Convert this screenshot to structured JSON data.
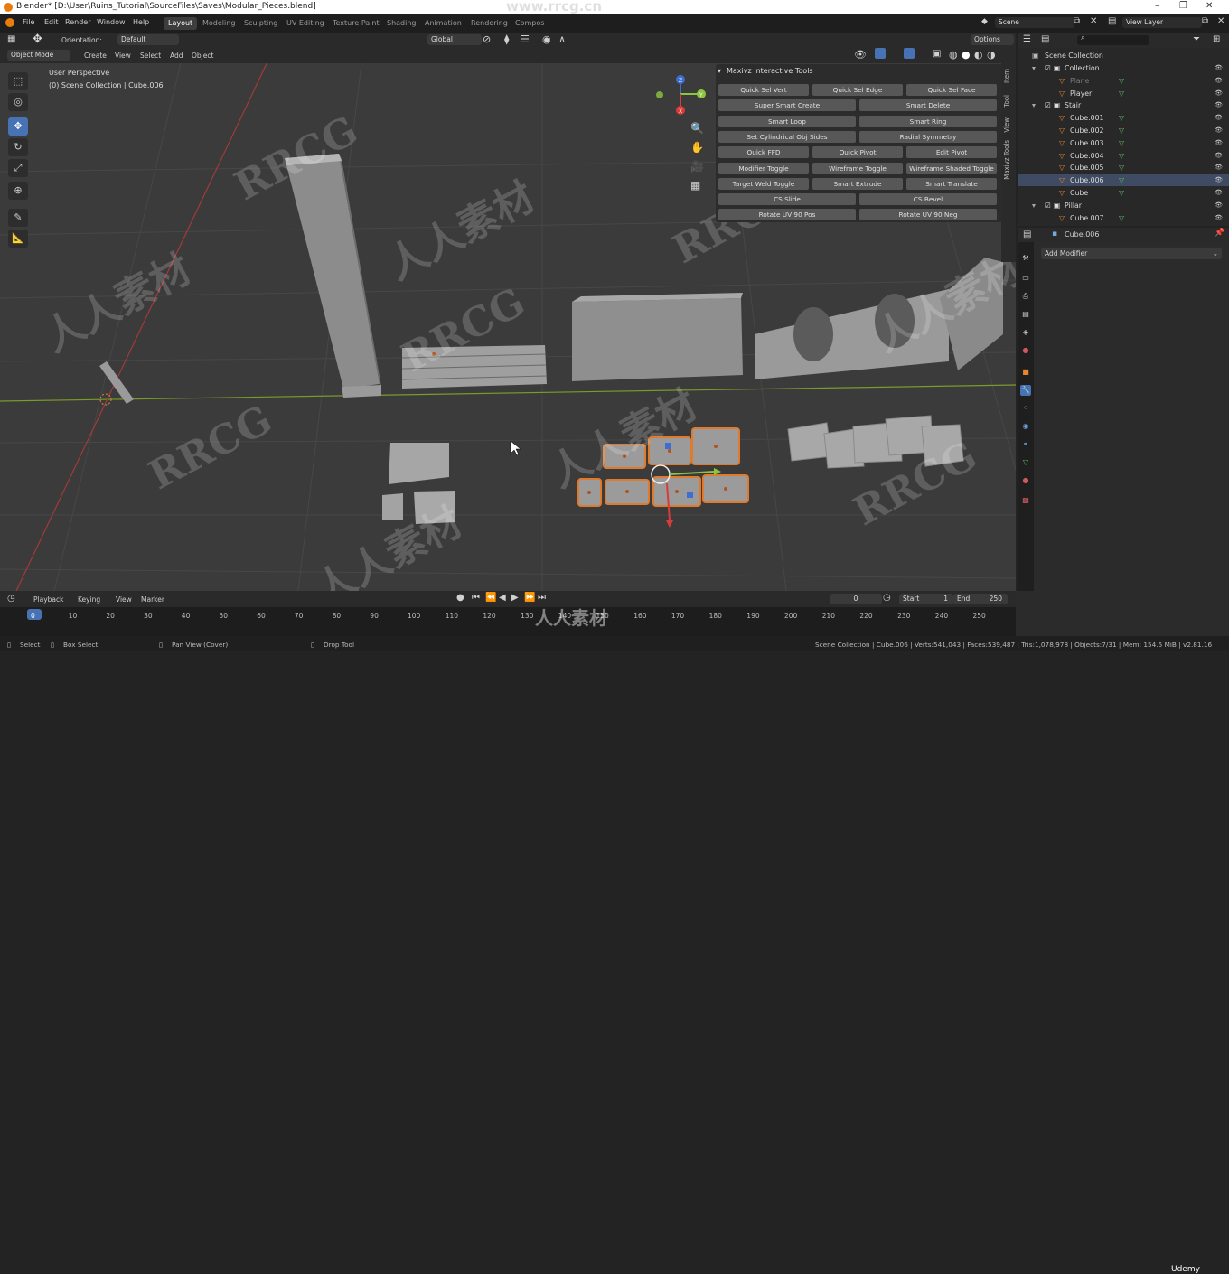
{
  "window_title": "Blender* [D:\\User\\Ruins_Tutorial\\SourceFiles\\Saves\\Modular_Pieces.blend]",
  "menus": [
    "File",
    "Edit",
    "Render",
    "Window",
    "Help"
  ],
  "workspaces": [
    "Layout",
    "Modeling",
    "Sculpting",
    "UV Editing",
    "Texture Paint",
    "Shading",
    "Animation",
    "Rendering",
    "Compos"
  ],
  "active_workspace": "Layout",
  "site_watermark": "www.rrcg.cn",
  "scene_field": "Scene",
  "view_layer_field": "View Layer",
  "header": {
    "orientation_label": "Orientation:",
    "orientation_value": "Default",
    "transform_space": "Global",
    "options": "Options",
    "mode": "Object Mode",
    "menus": [
      "View",
      "Select",
      "Add",
      "Object"
    ],
    "create": "Create"
  },
  "viewport": {
    "view_name": "User Perspective",
    "context": "(0) Scene Collection | Cube.006",
    "gizmo": {
      "x": "X",
      "y": "Y",
      "z": "Z"
    },
    "watermarks": [
      "RRCG",
      "人人素材"
    ]
  },
  "npanel": {
    "title": "Maxivz Interactive Tools",
    "buttons": [
      [
        "Quick Sel Vert",
        "Quick Sel Edge",
        "Quick Sel Face"
      ],
      [
        "Super Smart Create",
        "Smart Delete"
      ],
      [
        "Smart Loop",
        "Smart Ring"
      ],
      [
        "Set Cylindrical Obj Sides",
        "Radial Symmetry"
      ],
      [
        "Quick FFD",
        "Quick Pivot",
        "Edit Pivot"
      ],
      [
        "Modifier Toggle",
        "Wireframe Toggle",
        "Wireframe Shaded Toggle"
      ],
      [
        "Target Weld Toggle",
        "Smart Extrude",
        "Smart Translate"
      ],
      [
        "CS Slide",
        "CS Bevel"
      ],
      [
        "Rotate UV 90 Pos",
        "Rotate UV 90 Neg"
      ]
    ],
    "tabs": [
      "Item",
      "Tool",
      "View",
      "Maxivz Tools"
    ]
  },
  "outliner": {
    "root": "Scene Collection",
    "rows": [
      {
        "name": "Collection",
        "level": 1,
        "type": "collection"
      },
      {
        "name": "Plane",
        "level": 2,
        "type": "mesh",
        "dim": true
      },
      {
        "name": "Player",
        "level": 2,
        "type": "mesh"
      },
      {
        "name": "Stair",
        "level": 1,
        "type": "collection"
      },
      {
        "name": "Cube.001",
        "level": 2,
        "type": "mesh"
      },
      {
        "name": "Cube.002",
        "level": 2,
        "type": "mesh"
      },
      {
        "name": "Cube.003",
        "level": 2,
        "type": "mesh"
      },
      {
        "name": "Cube.004",
        "level": 2,
        "type": "mesh"
      },
      {
        "name": "Cube.005",
        "level": 2,
        "type": "mesh"
      },
      {
        "name": "Cube.006",
        "level": 2,
        "type": "mesh",
        "selected": true
      },
      {
        "name": "Cube",
        "level": 2,
        "type": "mesh"
      },
      {
        "name": "Pillar",
        "level": 1,
        "type": "collection"
      },
      {
        "name": "Cube.007",
        "level": 2,
        "type": "mesh"
      }
    ]
  },
  "properties": {
    "object_name": "Cube.006",
    "add_modifier": "Add Modifier"
  },
  "timeline": {
    "menus": [
      "Playback",
      "Keying",
      "View",
      "Marker"
    ],
    "current_frame": "0",
    "start_label": "Start",
    "start": "1",
    "end_label": "End",
    "end": "250",
    "ticks": [
      "0",
      "10",
      "20",
      "30",
      "40",
      "50",
      "60",
      "70",
      "80",
      "90",
      "100",
      "110",
      "120",
      "130",
      "140",
      "150",
      "160",
      "170",
      "180",
      "190",
      "200",
      "210",
      "220",
      "230",
      "240",
      "250"
    ]
  },
  "statusbar": {
    "select": "Select",
    "box_select": "Box Select",
    "pan_view": "Pan View (Cover)",
    "drop_tool": "Drop Tool",
    "stats": "Scene Collection | Cube.006 | Verts:541,043 | Faces:539,487 | Tris:1,078,978 | Objects:7/31 | Mem: 154.5 MiB | v2.81.16",
    "udemy": "Udemy"
  },
  "colors": {
    "accent": "#4772b3",
    "selection": "#e07b2e",
    "bg": "#3b3b3b"
  }
}
